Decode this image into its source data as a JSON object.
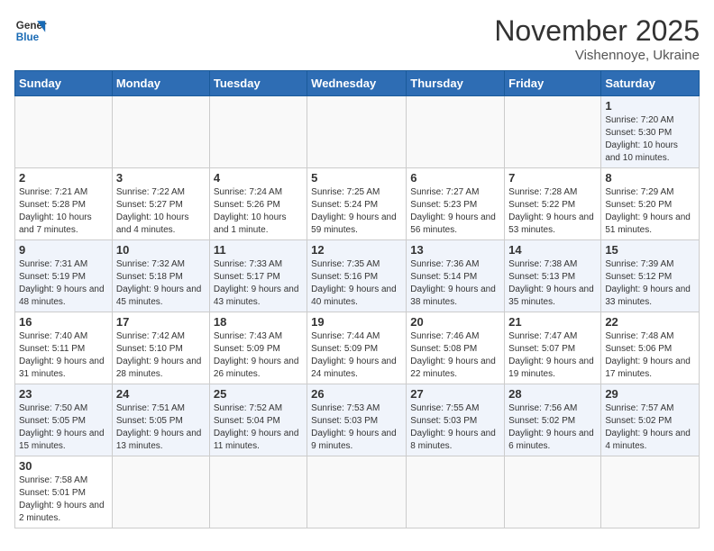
{
  "logo": {
    "line1": "General",
    "line2": "Blue"
  },
  "title": "November 2025",
  "subtitle": "Vishennoye, Ukraine",
  "weekdays": [
    "Sunday",
    "Monday",
    "Tuesday",
    "Wednesday",
    "Thursday",
    "Friday",
    "Saturday"
  ],
  "weeks": [
    [
      {
        "day": "",
        "info": ""
      },
      {
        "day": "",
        "info": ""
      },
      {
        "day": "",
        "info": ""
      },
      {
        "day": "",
        "info": ""
      },
      {
        "day": "",
        "info": ""
      },
      {
        "day": "",
        "info": ""
      },
      {
        "day": "1",
        "info": "Sunrise: 7:20 AM\nSunset: 5:30 PM\nDaylight: 10 hours and 10 minutes."
      }
    ],
    [
      {
        "day": "2",
        "info": "Sunrise: 7:21 AM\nSunset: 5:28 PM\nDaylight: 10 hours and 7 minutes."
      },
      {
        "day": "3",
        "info": "Sunrise: 7:22 AM\nSunset: 5:27 PM\nDaylight: 10 hours and 4 minutes."
      },
      {
        "day": "4",
        "info": "Sunrise: 7:24 AM\nSunset: 5:26 PM\nDaylight: 10 hours and 1 minute."
      },
      {
        "day": "5",
        "info": "Sunrise: 7:25 AM\nSunset: 5:24 PM\nDaylight: 9 hours and 59 minutes."
      },
      {
        "day": "6",
        "info": "Sunrise: 7:27 AM\nSunset: 5:23 PM\nDaylight: 9 hours and 56 minutes."
      },
      {
        "day": "7",
        "info": "Sunrise: 7:28 AM\nSunset: 5:22 PM\nDaylight: 9 hours and 53 minutes."
      },
      {
        "day": "8",
        "info": "Sunrise: 7:29 AM\nSunset: 5:20 PM\nDaylight: 9 hours and 51 minutes."
      }
    ],
    [
      {
        "day": "9",
        "info": "Sunrise: 7:31 AM\nSunset: 5:19 PM\nDaylight: 9 hours and 48 minutes."
      },
      {
        "day": "10",
        "info": "Sunrise: 7:32 AM\nSunset: 5:18 PM\nDaylight: 9 hours and 45 minutes."
      },
      {
        "day": "11",
        "info": "Sunrise: 7:33 AM\nSunset: 5:17 PM\nDaylight: 9 hours and 43 minutes."
      },
      {
        "day": "12",
        "info": "Sunrise: 7:35 AM\nSunset: 5:16 PM\nDaylight: 9 hours and 40 minutes."
      },
      {
        "day": "13",
        "info": "Sunrise: 7:36 AM\nSunset: 5:14 PM\nDaylight: 9 hours and 38 minutes."
      },
      {
        "day": "14",
        "info": "Sunrise: 7:38 AM\nSunset: 5:13 PM\nDaylight: 9 hours and 35 minutes."
      },
      {
        "day": "15",
        "info": "Sunrise: 7:39 AM\nSunset: 5:12 PM\nDaylight: 9 hours and 33 minutes."
      }
    ],
    [
      {
        "day": "16",
        "info": "Sunrise: 7:40 AM\nSunset: 5:11 PM\nDaylight: 9 hours and 31 minutes."
      },
      {
        "day": "17",
        "info": "Sunrise: 7:42 AM\nSunset: 5:10 PM\nDaylight: 9 hours and 28 minutes."
      },
      {
        "day": "18",
        "info": "Sunrise: 7:43 AM\nSunset: 5:09 PM\nDaylight: 9 hours and 26 minutes."
      },
      {
        "day": "19",
        "info": "Sunrise: 7:44 AM\nSunset: 5:09 PM\nDaylight: 9 hours and 24 minutes."
      },
      {
        "day": "20",
        "info": "Sunrise: 7:46 AM\nSunset: 5:08 PM\nDaylight: 9 hours and 22 minutes."
      },
      {
        "day": "21",
        "info": "Sunrise: 7:47 AM\nSunset: 5:07 PM\nDaylight: 9 hours and 19 minutes."
      },
      {
        "day": "22",
        "info": "Sunrise: 7:48 AM\nSunset: 5:06 PM\nDaylight: 9 hours and 17 minutes."
      }
    ],
    [
      {
        "day": "23",
        "info": "Sunrise: 7:50 AM\nSunset: 5:05 PM\nDaylight: 9 hours and 15 minutes."
      },
      {
        "day": "24",
        "info": "Sunrise: 7:51 AM\nSunset: 5:05 PM\nDaylight: 9 hours and 13 minutes."
      },
      {
        "day": "25",
        "info": "Sunrise: 7:52 AM\nSunset: 5:04 PM\nDaylight: 9 hours and 11 minutes."
      },
      {
        "day": "26",
        "info": "Sunrise: 7:53 AM\nSunset: 5:03 PM\nDaylight: 9 hours and 9 minutes."
      },
      {
        "day": "27",
        "info": "Sunrise: 7:55 AM\nSunset: 5:03 PM\nDaylight: 9 hours and 8 minutes."
      },
      {
        "day": "28",
        "info": "Sunrise: 7:56 AM\nSunset: 5:02 PM\nDaylight: 9 hours and 6 minutes."
      },
      {
        "day": "29",
        "info": "Sunrise: 7:57 AM\nSunset: 5:02 PM\nDaylight: 9 hours and 4 minutes."
      }
    ],
    [
      {
        "day": "30",
        "info": "Sunrise: 7:58 AM\nSunset: 5:01 PM\nDaylight: 9 hours and 2 minutes."
      },
      {
        "day": "",
        "info": ""
      },
      {
        "day": "",
        "info": ""
      },
      {
        "day": "",
        "info": ""
      },
      {
        "day": "",
        "info": ""
      },
      {
        "day": "",
        "info": ""
      },
      {
        "day": "",
        "info": ""
      }
    ]
  ]
}
